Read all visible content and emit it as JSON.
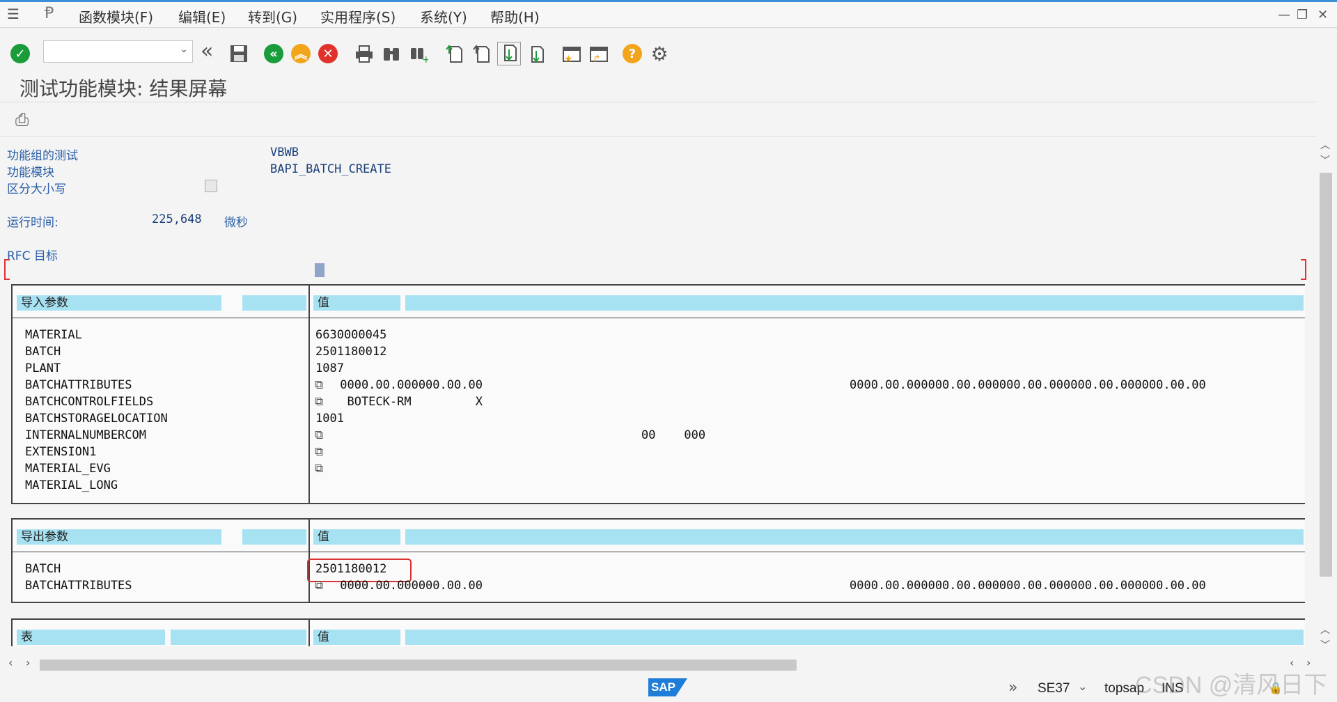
{
  "menu": {
    "items": [
      "函数模块(F)",
      "编辑(E)",
      "转到(G)",
      "实用程序(S)",
      "系统(Y)",
      "帮助(H)"
    ]
  },
  "title": "测试功能模块: 结果屏幕",
  "info": {
    "group_label": "功能组的测试",
    "group_value": "VBWB",
    "module_label": "功能模块",
    "module_value": "BAPI_BATCH_CREATE",
    "case_label": "区分大小写",
    "runtime_label": "运行时间:",
    "runtime_value": "225,648",
    "runtime_unit": "微秒",
    "rfc_label": "RFC 目标"
  },
  "import_table": {
    "header": "导入参数",
    "value_header": "值",
    "rows": [
      {
        "name": "MATERIAL",
        "value": "6630000045"
      },
      {
        "name": "BATCH",
        "value": "2501180012"
      },
      {
        "name": "PLANT",
        "value": "1087"
      },
      {
        "name": "BATCHATTRIBUTES",
        "value": " 0000.00.000000.00.00",
        "value2": "0000.00.000000.00.000000.00.000000.00.000000.00.00"
      },
      {
        "name": "BATCHCONTROLFIELDS",
        "value": "  BOTECK-RM         X"
      },
      {
        "name": "BATCHSTORAGELOCATION",
        "value": "1001"
      },
      {
        "name": "INTERNALNUMBERCOM",
        "value": "",
        "value2": "00    000"
      },
      {
        "name": "EXTENSION1",
        "value": ""
      },
      {
        "name": "MATERIAL_EVG",
        "value": ""
      },
      {
        "name": "MATERIAL_LONG",
        "value": ""
      }
    ]
  },
  "export_table": {
    "header": "导出参数",
    "value_header": "值",
    "rows": [
      {
        "name": "BATCH",
        "value": "2501180012"
      },
      {
        "name": "BATCHATTRIBUTES",
        "value": " 0000.00.000000.00.00",
        "value2": "0000.00.000000.00.000000.00.000000.00.000000.00.00"
      }
    ]
  },
  "tables_table": {
    "header": "表",
    "value_header": "值"
  },
  "status": {
    "logo": "SAP",
    "transaction": "SE37",
    "server": "topsap",
    "mode": "INS",
    "watermark": "CSDN @清风日下"
  },
  "colors": {
    "header_bg": "#a7e2f3",
    "ok_green": "#1a9c3a",
    "back_green": "#1a9c3a",
    "exit_orange": "#f2a51a",
    "cancel_red": "#e0312b",
    "help_orange": "#f2a51a",
    "highlight_red": "#d93030"
  }
}
